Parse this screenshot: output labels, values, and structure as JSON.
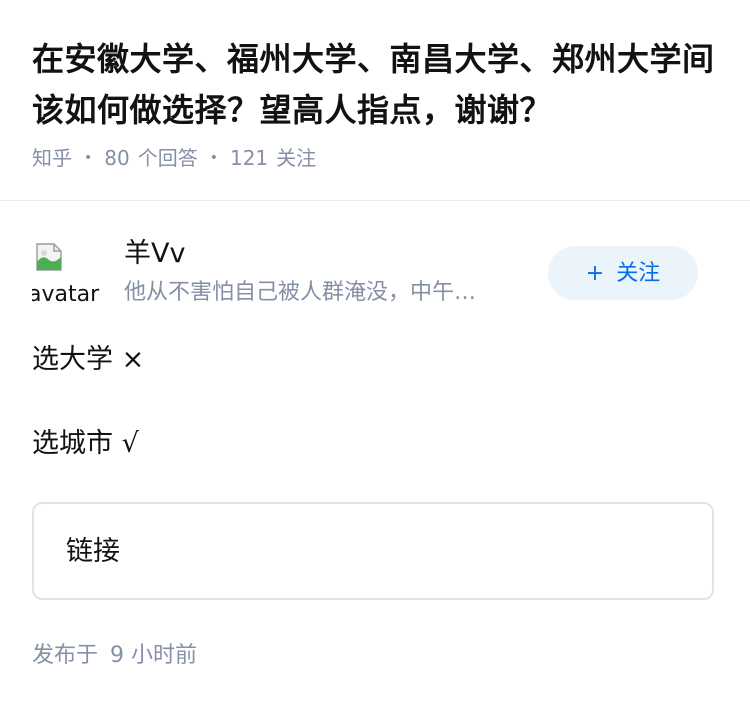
{
  "question": {
    "title": "在安徽大学、福州大学、南昌大学、郑州大学间该如何做选择？望高人指点，谢谢？",
    "source": "知乎",
    "answer_count": "80",
    "answer_label": "个回答",
    "follower_count": "121",
    "follower_label": "关注"
  },
  "author": {
    "avatar_alt": "avatar",
    "name": "羊Vv",
    "bio": "他从不害怕自己被人群淹没，中午…",
    "follow_label": "关注",
    "follow_plus": "+"
  },
  "answer": {
    "paragraphs": [
      "选大学 ×",
      "选城市 √"
    ],
    "link_card_title": "链接",
    "publish_prefix": "发布于",
    "publish_time": "9 小时前"
  },
  "colors": {
    "muted": "#8590a6",
    "brand_blue": "#056de8",
    "follow_bg": "#ebf3fb"
  }
}
